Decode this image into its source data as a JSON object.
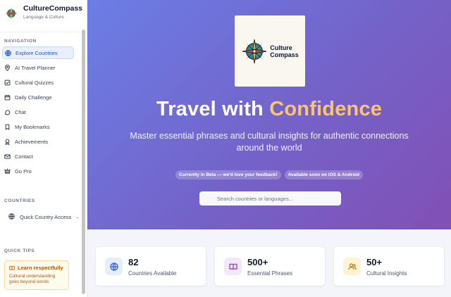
{
  "brand": {
    "name": "CultureCompass",
    "subtitle": "Language & Culture"
  },
  "sidebar": {
    "nav_title": "NAVIGATION",
    "items": [
      {
        "label": "Explore Countries",
        "icon": "globe-icon",
        "active": true
      },
      {
        "label": "AI Travel Planner",
        "icon": "map-pin-icon",
        "active": false
      },
      {
        "label": "Cultural Quizzes",
        "icon": "quiz-icon",
        "active": false
      },
      {
        "label": "Daily Challenge",
        "icon": "calendar-icon",
        "active": false
      },
      {
        "label": "Chat",
        "icon": "chat-icon",
        "active": false
      },
      {
        "label": "My Bookmarks",
        "icon": "bookmark-icon",
        "active": false
      },
      {
        "label": "Achievements",
        "icon": "award-icon",
        "active": false
      },
      {
        "label": "Contact",
        "icon": "mail-icon",
        "active": false
      },
      {
        "label": "Go Pro",
        "icon": "crown-icon",
        "active": false
      }
    ],
    "countries_title": "COUNTRIES",
    "quick_access": "Quick Country Access",
    "tips_title": "QUICK TIPS",
    "tip": {
      "title": "Learn respectfully",
      "body": "Cultural understanding goes beyond words"
    }
  },
  "hero": {
    "logo_text_1": "Culture",
    "logo_text_2": "Compass",
    "headline_pre": "Travel with ",
    "headline_accent": "Confidence",
    "subtitle": "Master essential phrases and cultural insights for authentic connections around the world",
    "badges": [
      "Currently in Beta — we'd love your feedback!",
      "Available soon on iOS & Android"
    ],
    "search_placeholder": "Search countries or languages..."
  },
  "stats": [
    {
      "value": "82",
      "label": "Countries Available",
      "icon": "globe-icon",
      "bg": "#e6eefc",
      "stroke": "#3b6fd8"
    },
    {
      "value": "500+",
      "label": "Essential Phrases",
      "icon": "book-icon",
      "bg": "#f3e8fb",
      "stroke": "#9b4fc9"
    },
    {
      "value": "50+",
      "label": "Cultural Insights",
      "icon": "users-icon",
      "bg": "#fdf3d6",
      "stroke": "#c98a1a"
    }
  ],
  "colors": {
    "accent": "#fcc56b",
    "active_nav": "#1d4ed8"
  }
}
